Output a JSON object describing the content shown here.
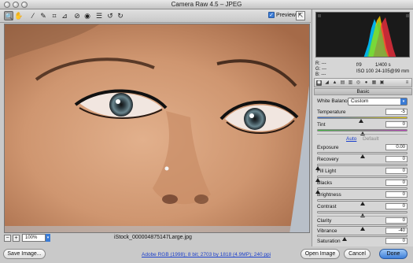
{
  "window": {
    "title": "Camera Raw 4.5  –  JPEG"
  },
  "toolbar": {
    "tools": [
      {
        "icon": "zoom-icon",
        "glyph": "🔍"
      },
      {
        "icon": "hand-icon",
        "glyph": "✋"
      },
      {
        "icon": "white-balance-icon",
        "glyph": "⁄"
      },
      {
        "icon": "color-sampler-icon",
        "glyph": "✎"
      },
      {
        "icon": "crop-icon",
        "glyph": "⌗"
      },
      {
        "icon": "straighten-icon",
        "glyph": "⊿"
      },
      {
        "icon": "retouch-icon",
        "glyph": "⊘"
      },
      {
        "icon": "red-eye-icon",
        "glyph": "◉"
      },
      {
        "icon": "preferences-icon",
        "glyph": "☰"
      },
      {
        "icon": "rotate-left-icon",
        "glyph": "↺"
      },
      {
        "icon": "rotate-right-icon",
        "glyph": "↻"
      }
    ],
    "preview_label": "Preview",
    "preview_checked": true
  },
  "image": {
    "zoom": "100%",
    "filename": "iStock_000004875147Large.jpg"
  },
  "histogram": {
    "r_label": "R:",
    "r_value": "---",
    "g_label": "G:",
    "g_value": "---",
    "b_label": "B:",
    "b_value": "---",
    "aperture": "f/9",
    "shutter": "1/400 s",
    "iso": "ISO 100",
    "lens": "24-105@99 mm"
  },
  "panel": {
    "section_title": "Basic",
    "white_balance_label": "White Balance:",
    "white_balance_value": "Custom",
    "auto_label": "Auto",
    "default_label": "Default",
    "sliders": {
      "temperature": {
        "label": "Temperature",
        "value": "-5",
        "pos": 0.49
      },
      "tint": {
        "label": "Tint",
        "value": "0",
        "pos": 0.5
      },
      "exposure": {
        "label": "Exposure",
        "value": "0.00",
        "pos": 0.5
      },
      "recovery": {
        "label": "Recovery",
        "value": "0",
        "pos": 0.0
      },
      "fill_light": {
        "label": "Fill Light",
        "value": "0",
        "pos": 0.0
      },
      "blacks": {
        "label": "Blacks",
        "value": "0",
        "pos": 0.0
      },
      "brightness": {
        "label": "Brightness",
        "value": "0",
        "pos": 0.5
      },
      "contrast": {
        "label": "Contrast",
        "value": "0",
        "pos": 0.5
      },
      "clarity": {
        "label": "Clarity",
        "value": "0",
        "pos": 0.5
      },
      "vibrance": {
        "label": "Vibrance",
        "value": "-40",
        "pos": 0.3
      },
      "saturation": {
        "label": "Saturation",
        "value": "0",
        "pos": 0.5
      }
    }
  },
  "bottom": {
    "save_label": "Save Image...",
    "workflow_link": "Adobe RGB (1998); 8 bit; 2703 by 1818 (4.9MP); 240 ppi",
    "open_label": "Open Image",
    "cancel_label": "Cancel",
    "done_label": "Done"
  }
}
